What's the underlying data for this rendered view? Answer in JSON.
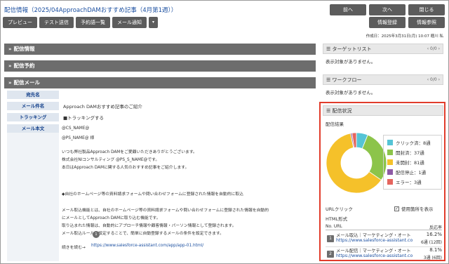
{
  "title": "配信情報（2025/04ApproachDAMおすすめ記事（4月第1週））",
  "toolbar": [
    "プレビュー",
    "テスト送信",
    "予約語一覧",
    "メール通知",
    "▾"
  ],
  "nav": {
    "prev": "前へ",
    "next": "次へ",
    "close": "閉じる",
    "register": "情報登録",
    "reference": "情報参照"
  },
  "meta": "作成日：2025年3月31日(月) 10:07  榧川 私",
  "sections": {
    "info": "配信情報",
    "reserve": "配信予約",
    "mail": "配信メール"
  },
  "mail": {
    "labels": {
      "to": "宛先名",
      "subject": "メール件名",
      "tracking": "トラッキング",
      "body": "メール本文"
    },
    "subject": "Approach DAMおすすめ記事のご紹介",
    "tracking": "■トラッキングする",
    "body": [
      "@CS_NAME@",
      "@PS_NAME@ 様",
      "いつも弊社製品Approach DAMをご愛顧いただきありがとうございます。",
      "株式会社NIコンサルティング @PS_S_NAME@です。",
      "本日はApproach DAMに関する人気のおすすめ記事をご紹介します。",
      "◆自社のホームページ等の資料請求フォームや問い合わせフォームに登録された情報を自動的に取込",
      "メール取込機能とは、自社のホームページ等の資料請求フォームや問い合わせフォームに登録された情報を自動的",
      "にメールとしてApproach DAMに取り込む機能です。",
      "取り込まれた情報は、自動的にアプローチ情報や顧客情報・パーソン情報として登録されます。",
      "メール取込ルールを設定することで、簡単に自動登録するメールの条件を設定できます。",
      "続きを読む→",
      "https://www.salesforce-assistant.com/app/app-01.html/"
    ],
    "badge": "1"
  },
  "target": {
    "title": "ターゲットリスト",
    "pager": "0/0",
    "empty": "表示対象がありません。"
  },
  "workflow": {
    "title": "ワークフロー",
    "pager": "0/0",
    "empty": "表示対象がありません。"
  },
  "status": {
    "title": "配信状況",
    "result_label": "配信結果",
    "legend": [
      "クリック済：8通",
      "開封済：37通",
      "未開封：81通",
      "配信停止：1通",
      "エラー：3通"
    ],
    "url_click": "URLクリック",
    "usage_label": "使用箇所を表示",
    "format": "HTML形式",
    "col_no_url": "No. URL",
    "col_rate": "反応率",
    "rows": [
      {
        "no": "1",
        "title": "メール取込｜マーケティング・オート",
        "url": "https://www.salesforce-assistant.co",
        "rate": "16.2%",
        "count": "6通 (12回)"
      },
      {
        "no": "2",
        "title": "メール配信｜マーケティング・オート",
        "url": "https://www.salesforce-assistant.co",
        "rate": "8.1%",
        "count": "3通 (6回)"
      }
    ]
  },
  "chart_data": {
    "type": "pie",
    "categories": [
      "クリック済",
      "開封済",
      "未開封",
      "配信停止",
      "エラー"
    ],
    "values": [
      8,
      37,
      81,
      1,
      3
    ],
    "colors": [
      "#55c4d6",
      "#8cc44a",
      "#f5c12a",
      "#8e5aa6",
      "#e5655e"
    ],
    "donut": true
  }
}
